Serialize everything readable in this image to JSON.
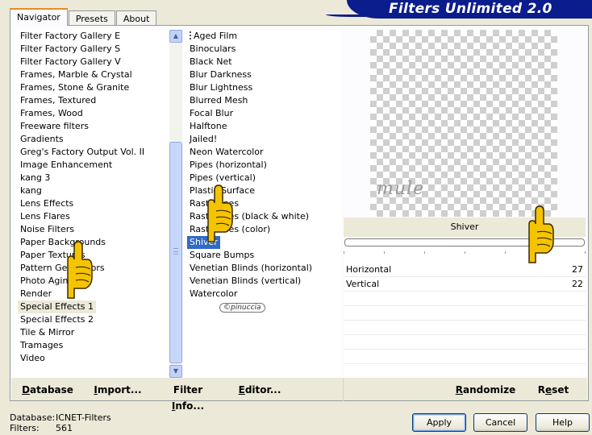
{
  "tabs": [
    "Navigator",
    "Presets",
    "About"
  ],
  "banner": "Filters Unlimited 2.0",
  "categories": [
    "Filter Factory Gallery E",
    "Filter Factory Gallery S",
    "Filter Factory Gallery V",
    "Frames, Marble & Crystal",
    "Frames, Stone & Granite",
    "Frames, Textured",
    "Frames, Wood",
    "Freeware filters",
    "Gradients",
    "Greg's Factory Output Vol. II",
    "Image Enhancement",
    "kang 3",
    "kang",
    "Lens Effects",
    "Lens Flares",
    "Noise Filters",
    "Paper Backgrounds",
    "Paper Textures",
    "Pattern Generators",
    "Photo Aging Kit",
    "Render",
    "Special Effects 1",
    "Special Effects 2",
    "Tile & Mirror",
    "Tramages",
    "Video"
  ],
  "selected_category": "Special Effects 1",
  "filters": [
    "Aged Film",
    "Binoculars",
    "Black Net",
    "Blur Darkness",
    "Blur Lightness",
    "Blurred Mesh",
    "Focal Blur",
    "Halftone",
    "Jailed!",
    "Neon Watercolor",
    "Pipes (horizontal)",
    "Pipes (vertical)",
    "Plastic Surface",
    "Rasterlines",
    "Rasterlines (black & white)",
    "Rasterlines (color)",
    "Shiver",
    "Square Bumps",
    "Venetian Blinds (horizontal)",
    "Venetian Blinds (vertical)",
    "Watercolor"
  ],
  "selected_filter": "Shiver",
  "preview_watermark": "mule",
  "filter_watermark": "©pinuccia",
  "params": {
    "title": "Shiver",
    "rows": [
      {
        "name": "Horizontal",
        "value": "27"
      },
      {
        "name": "Vertical",
        "value": "22"
      }
    ]
  },
  "bottom_buttons": {
    "database": {
      "pre": "",
      "u": "D",
      "post": "atabase"
    },
    "import": {
      "pre": "",
      "u": "I",
      "post": "mport..."
    },
    "filter_info": {
      "pre": "Filter ",
      "u": "I",
      "post": "nfo..."
    },
    "editor": {
      "pre": "",
      "u": "E",
      "post": "ditor..."
    },
    "randomize": {
      "pre": "",
      "u": "R",
      "post": "andomize"
    },
    "reset": {
      "pre": "R",
      "u": "e",
      "post": "set"
    }
  },
  "status": {
    "database_label": "Database:",
    "database_value": "ICNET-Filters",
    "filters_label": "Filters:",
    "filters_value": "561"
  },
  "dialog_buttons": {
    "apply": "Apply",
    "cancel": "Cancel",
    "help": "Help"
  },
  "colors": {
    "selection": "#316ac5",
    "banner": "#0b1c8c",
    "hand": "#f5c400"
  }
}
